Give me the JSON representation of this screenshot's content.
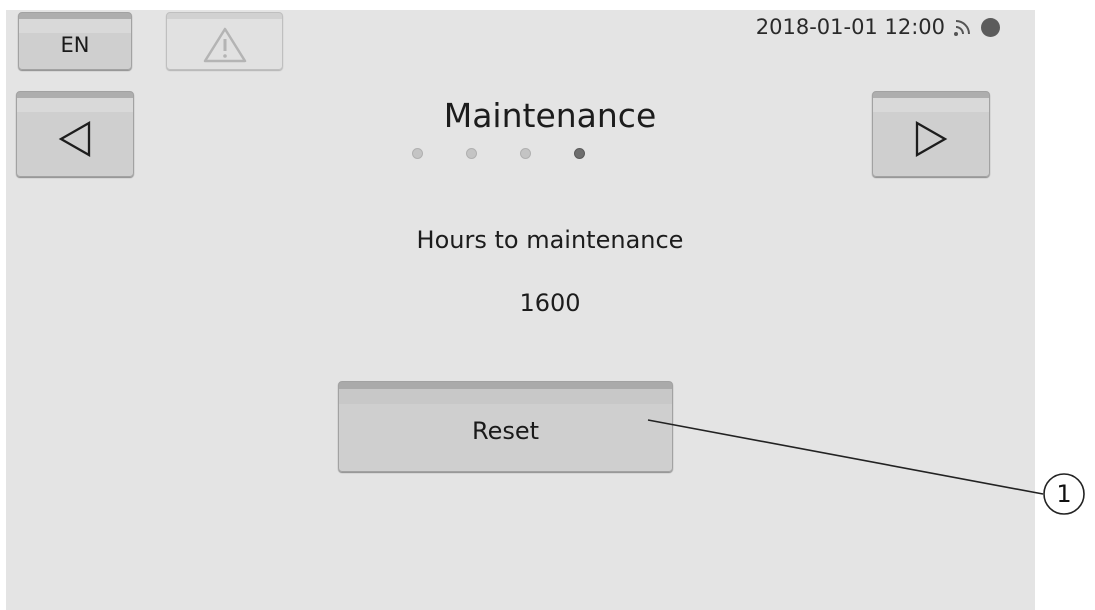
{
  "header": {
    "language_label": "EN",
    "alert_icon": "warning-triangle-icon",
    "datetime": "2018-01-01 12:00",
    "signal_icon": "wifi-signal-icon",
    "status_icon": "status-dot-icon"
  },
  "navigation": {
    "prev_icon": "triangle-left-icon",
    "next_icon": "triangle-right-icon",
    "page_count": 4,
    "active_page": 4
  },
  "main": {
    "title": "Maintenance",
    "field_label": "Hours to maintenance",
    "field_value": "1600",
    "reset_label": "Reset"
  },
  "callout": {
    "number": "1"
  },
  "colors": {
    "screen_bg": "#e4e4e4",
    "button_face": "#cfcfcf",
    "button_top": "#aeaeae",
    "active_dot": "#6e6e6e",
    "inactive_dot": "#c4c4c4"
  }
}
